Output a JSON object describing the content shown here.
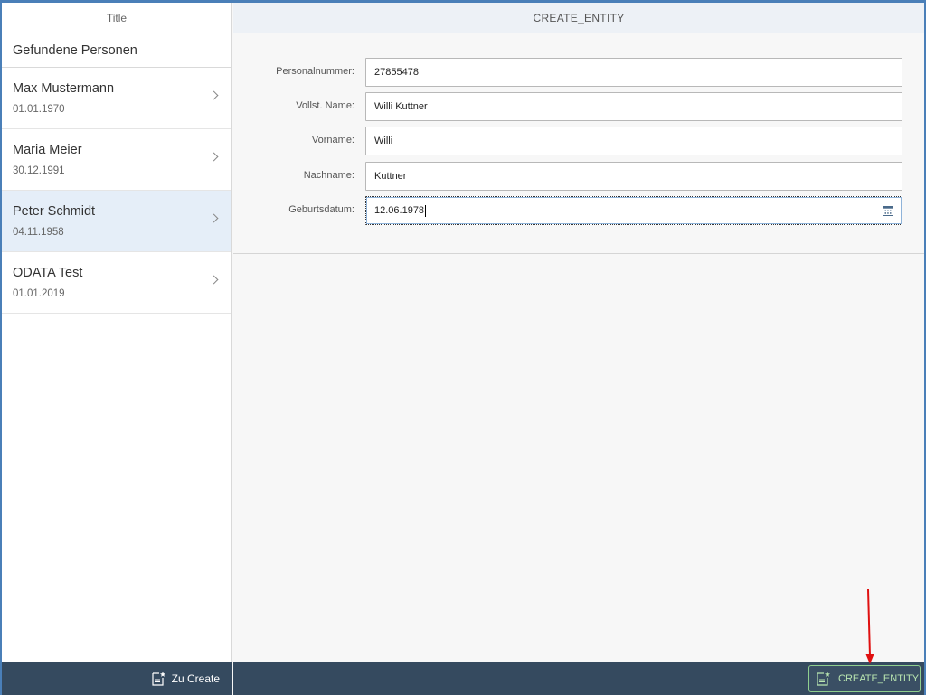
{
  "master": {
    "title": "Title",
    "list_header": "Gefundene Personen",
    "items": [
      {
        "name": "Max Mustermann",
        "date": "01.01.1970"
      },
      {
        "name": "Maria Meier",
        "date": "30.12.1991"
      },
      {
        "name": "Peter Schmidt",
        "date": "04.11.1958"
      },
      {
        "name": "ODATA Test",
        "date": "01.01.2019"
      }
    ],
    "selected_index": 2,
    "footer_button": {
      "label": "Zu Create",
      "icon": "create-document-icon"
    }
  },
  "detail": {
    "title": "CREATE_ENTITY",
    "fields": [
      {
        "label": "Personalnummer:",
        "value": "27855478"
      },
      {
        "label": "Vollst. Name:",
        "value": "Willi Kuttner"
      },
      {
        "label": "Vorname:",
        "value": "Willi"
      },
      {
        "label": "Nachname:",
        "value": "Kuttner"
      },
      {
        "label": "Geburtsdatum:",
        "value": "12.06.1978",
        "icon": "calendar-icon"
      }
    ],
    "footer_button": {
      "label": "CREATE_ENTITY",
      "icon": "create-document-icon"
    }
  },
  "colors": {
    "footer_bg": "#354a5f",
    "selected_row": "#e5eef8",
    "accent_border": "#4a7fb8",
    "annotation_arrow": "#e01010"
  }
}
